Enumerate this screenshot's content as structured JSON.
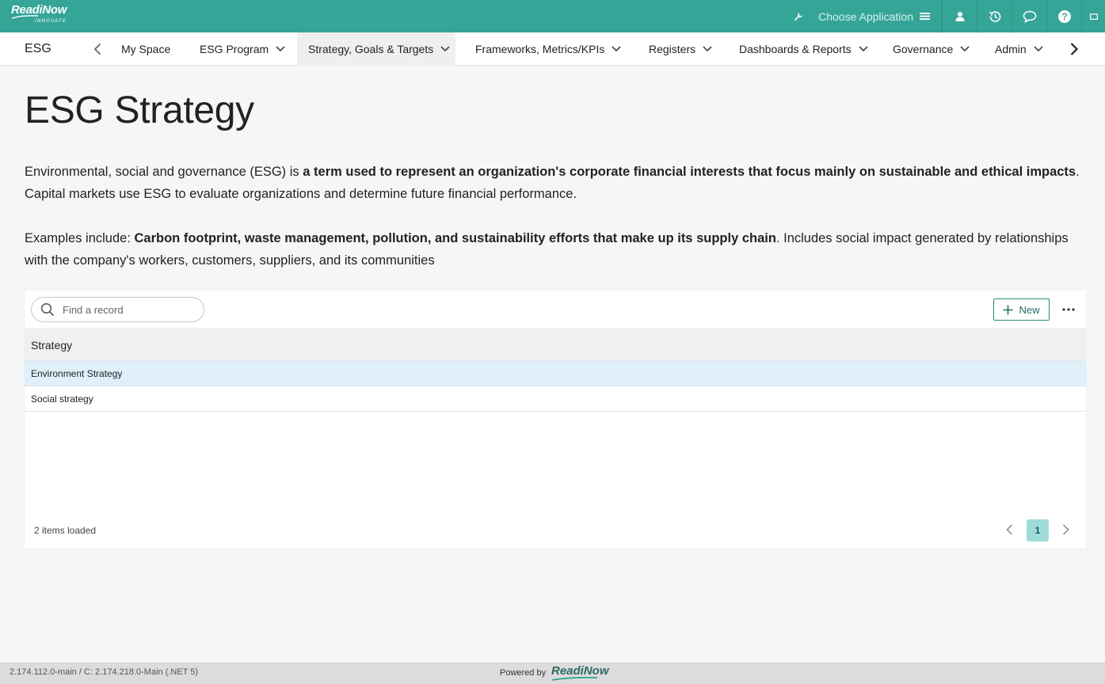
{
  "header": {
    "logo_text": "ReadiNow",
    "logo_subtext": "INNOVATE",
    "choose_application_label": "Choose Application",
    "icons": [
      "wrench-icon",
      "menu-icon",
      "user-icon",
      "history-icon",
      "chat-icon",
      "help-icon",
      "fullscreen-icon"
    ]
  },
  "nav": {
    "app_name": "ESG",
    "items": [
      {
        "label": "My Space",
        "has_dropdown": false
      },
      {
        "label": "ESG Program",
        "has_dropdown": true
      },
      {
        "label": "Strategy, Goals & Targets",
        "has_dropdown": true,
        "active": true
      },
      {
        "label": "Frameworks, Metrics/KPIs",
        "has_dropdown": true
      },
      {
        "label": "Registers",
        "has_dropdown": true
      },
      {
        "label": "Dashboards & Reports",
        "has_dropdown": true
      },
      {
        "label": "Governance",
        "has_dropdown": true
      },
      {
        "label": "Admin",
        "has_dropdown": true
      }
    ]
  },
  "page": {
    "title": "ESG Strategy",
    "intro": {
      "p1_a": "Environmental, social and governance (ESG) is ",
      "p1_b": "a term used to represent an organization's corporate financial interests that focus mainly on sustainable and ethical impacts",
      "p1_c": ". Capital markets use ESG to evaluate organizations and determine future financial performance.",
      "p2_a": "Examples include: ",
      "p2_b": "Carbon footprint, waste management, pollution, and sustainability efforts that make up its supply chain",
      "p2_c": ". Includes social impact generated by relationships with the company's workers, customers, suppliers, and its communities"
    }
  },
  "grid": {
    "search_placeholder": "Find a record",
    "new_label": "New",
    "column_header": "Strategy",
    "rows": [
      {
        "label": "Environment Strategy",
        "selected": true
      },
      {
        "label": "Social strategy",
        "selected": false
      }
    ],
    "items_loaded": "2 items loaded",
    "current_page": "1"
  },
  "footer": {
    "version": "2.174.112.0-main / C: 2.174.218.0-Main (.NET 5)",
    "powered_by": "Powered by",
    "brand": "ReadiNow"
  },
  "colors": {
    "brand_teal": "#35a597",
    "selected_row": "#e0f0fb",
    "page_active": "#9fdcd7"
  }
}
